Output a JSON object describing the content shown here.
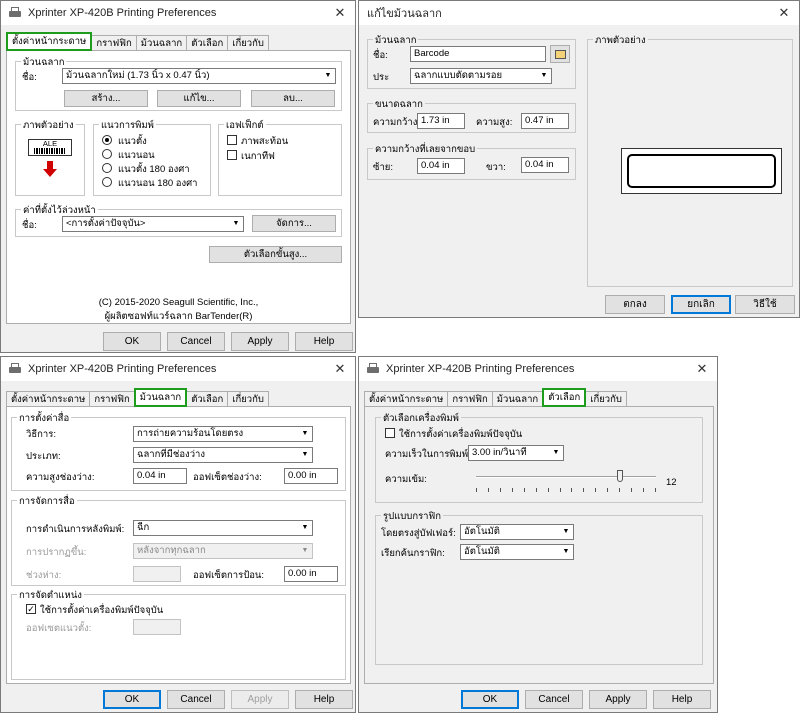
{
  "common": {
    "window_title": "Xprinter XP-420B Printing Preferences",
    "close_glyph": "✕",
    "tabs": [
      "ตั้งค่าหน้ากระดาษ",
      "กราฟฟิก",
      "ม้วนฉลาก",
      "ตัวเลือก",
      "เกี่ยวกับ"
    ],
    "ok": "OK",
    "cancel": "Cancel",
    "apply": "Apply",
    "help": "Help",
    "highlight_color": "#1e9c1e",
    "default_button_color": "#0078d7"
  },
  "w1": {
    "active_tab": "ตั้งค่าหน้ากระดาษ",
    "stock_group": "ม้วนฉลาก",
    "name_label": "ชื่อ:",
    "stock_value": "ม้วนฉลากใหม่ (1.73 นิ้ว x 0.47 นิ้ว)",
    "create_btn": "สร้าง...",
    "edit_btn": "แก้ไข...",
    "delete_btn": "ลบ...",
    "preview_group": "ภาพตัวอย่าง",
    "preview_label": "ALE",
    "orient_group": "แนวการพิมพ์",
    "orient": [
      "แนวตั้ง",
      "แนวนอน",
      "แนวตั้ง 180 องศา",
      "แนวนอน 180 องศา"
    ],
    "effects_group": "เอฟเฟ็กต์",
    "effects": [
      "ภาพสะท้อน",
      "เนกาทีฟ"
    ],
    "presets_group": "ค่าที่ตั้งไว้ล่วงหน้า",
    "preset_value": "<การตั้งค่าปัจจุบัน>",
    "manage_btn": "จัดการ...",
    "advanced_btn": "ตัวเลือกขั้นสูง...",
    "copyright1": "(C) 2015-2020 Seagull Scientific, Inc.,",
    "copyright2": "ผู้ผลิตซอฟท์แวร์ฉลาก BarTender(R)"
  },
  "w2": {
    "title": "แก้ไขม้วนฉลาก",
    "stock_group": "ม้วนฉลาก",
    "name_label": "ชื่อ:",
    "name_value": "Barcode",
    "type_label": "ประ",
    "type_value": "ฉลากแบบตัดตามรอย",
    "size_group": "ขนาดฉลาก",
    "width_label": "ความกว้าง:",
    "width_value": "1.73 in",
    "height_label": "ความสูง:",
    "height_value": "0.47 in",
    "margin_group": "ความกว้างที่เลยจากขอบ",
    "left_label": "ซ้าย:",
    "left_value": "0.04 in",
    "right_label": "ขวา:",
    "right_value": "0.04 in",
    "preview_group": "ภาพตัวอย่าง",
    "ok": "ตกลง",
    "cancel": "ยกเลิก",
    "help": "วิธีใช้"
  },
  "w3": {
    "active_tab": "ม้วนฉลาก",
    "params_group": "การตั้งค่าสื่อ",
    "method_label": "วิธีการ:",
    "method_value": "การถ่ายความร้อนโดยตรง",
    "type_label": "ประเภท:",
    "type_value": "ฉลากที่มีช่องว่าง",
    "gap_label": "ความสูงช่องว่าง:",
    "gap_value": "0.04 in",
    "gap_offset_label": "ออฟเซ็ตช่องว่าง:",
    "gap_offset_value": "0.00 in",
    "handling_group": "การจัดการสื่อ",
    "post_label": "การดำเนินการหลังพิมพ์:",
    "post_value": "ฉีก",
    "occurrence_label": "การปรากฏขึ้น:",
    "occurrence_value": "หลังจากทุกฉลาก",
    "interval_label": "ช่วงห่าง:",
    "feed_offset_label": "ออฟเซ็ตการป้อน:",
    "feed_offset_value": "0.00 in",
    "position_group": "การจัดตำแหน่ง",
    "use_printer_label": "ใช้การตั้งค่าเครื่องพิมพ์ปัจจุบัน",
    "vertical_offset_label": "ออฟเซตแนวตั้ง:"
  },
  "w4": {
    "active_tab": "ตัวเลือก",
    "printer_group": "ตัวเลือกเครื่องพิมพ์",
    "use_printer_label": "ใช้การตั้งค่าเครื่องพิมพ์ปัจจุบัน",
    "speed_label": "ความเร็วในการพิมพ์:",
    "speed_value": "3.00 in/วินาที",
    "darkness_label": "ความเข้ม:",
    "darkness_value": "12",
    "darkness_level": 12,
    "darkness_max": 15,
    "graphics_group": "รูปแบบกราฟิก",
    "dither_label": "โดยตรงสู่บัฟเฟอร์:",
    "dither_value": "อัตโนมัติ",
    "sort_label": "เรียกค้นกราฟิก:",
    "sort_value": "อัตโนมัติ"
  }
}
